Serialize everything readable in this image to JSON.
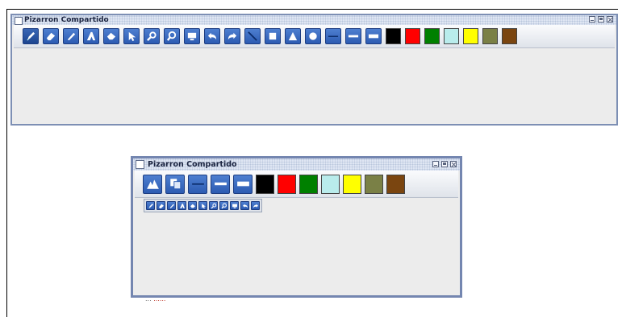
{
  "window1": {
    "title": "Pizarron Compartido",
    "tools": [
      {
        "name": "pencil-icon",
        "active": true
      },
      {
        "name": "eraser-icon"
      },
      {
        "name": "line-tool-icon"
      },
      {
        "name": "text-tool-icon"
      },
      {
        "name": "fill-tool-icon"
      },
      {
        "name": "select-arrow-icon"
      },
      {
        "name": "zoom-in-icon"
      },
      {
        "name": "zoom-out-icon"
      },
      {
        "name": "screen-icon"
      },
      {
        "name": "undo-icon"
      },
      {
        "name": "redo-icon"
      },
      {
        "name": "diagonal-line-icon"
      },
      {
        "name": "rectangle-icon"
      },
      {
        "name": "triangle-icon"
      },
      {
        "name": "circle-icon"
      },
      {
        "name": "thin-stroke-icon"
      },
      {
        "name": "medium-stroke-icon"
      },
      {
        "name": "thick-stroke-icon"
      }
    ],
    "colors": [
      "#000000",
      "#ff0000",
      "#008000",
      "#b9ecec",
      "#ffff00",
      "#7a8046",
      "#7a4510"
    ]
  },
  "window2": {
    "title": "Pizarron Compartido",
    "tools": [
      {
        "name": "drawing-tools-icon"
      },
      {
        "name": "copy-icon"
      },
      {
        "name": "thin-stroke-icon"
      },
      {
        "name": "medium-stroke-icon"
      },
      {
        "name": "thick-stroke-icon"
      }
    ],
    "colors": [
      "#000000",
      "#ff0000",
      "#008000",
      "#b9ecec",
      "#ffff00",
      "#7a8046",
      "#7a4510"
    ],
    "subtools": [
      "pencil-icon",
      "eraser-icon",
      "line-tool-icon",
      "text-tool-icon",
      "fill-tool-icon",
      "select-arrow-icon",
      "zoom-in-icon",
      "zoom-out-icon",
      "screen-icon",
      "undo-icon",
      "redo-icon"
    ]
  },
  "footer_clip": {
    "text1": "...",
    "text2": "......"
  }
}
